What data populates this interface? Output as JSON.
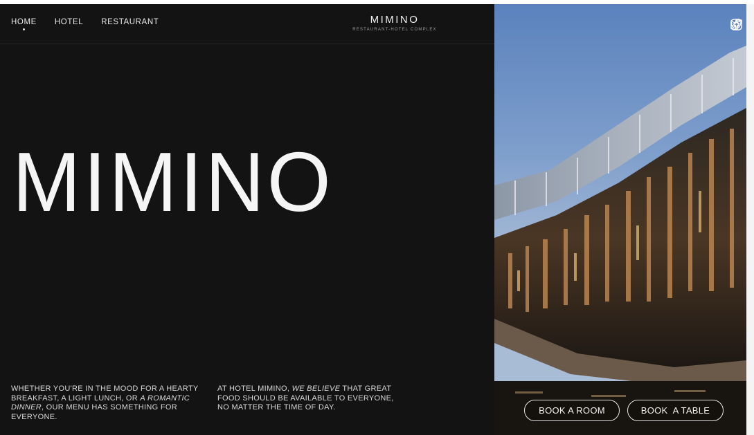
{
  "nav": {
    "items": [
      {
        "label": "HOME",
        "active": true
      },
      {
        "label": "HOTEL",
        "active": false
      },
      {
        "label": "RESTAURANT",
        "active": false
      }
    ]
  },
  "brand": {
    "name": "MIMINO",
    "subtitle": "RESTAURANT-HOTEL COMPLEX"
  },
  "hero": {
    "title": "MIMINO"
  },
  "copy": {
    "block1": {
      "part1": "WHETHER YOU'RE IN THE MOOD FOR A HEARTY BREAKFAST, A LIGHT LUNCH, OR ",
      "emphasis": "A ROMANTIC DINNER",
      "part2": ", OUR MENU HAS SOMETHING FOR EVERYONE."
    },
    "block2": {
      "part1": "AT HOTEL MIMINO, ",
      "emphasis": "WE BELIEVE",
      "part2": " THAT GREAT FOOD SHOULD BE AVAILABLE TO EVERYONE, NO MATTER THE TIME OF DAY."
    }
  },
  "social": {
    "icons": [
      "instagram-icon",
      "facebook-icon",
      "twitter-icon"
    ]
  },
  "buttons": {
    "book_room": "BOOK A ROOM",
    "book_table": "BOOK  A TABLE"
  },
  "colors": {
    "background": "#131313",
    "text": "#f5f5f5",
    "sky": "#7698c8"
  }
}
